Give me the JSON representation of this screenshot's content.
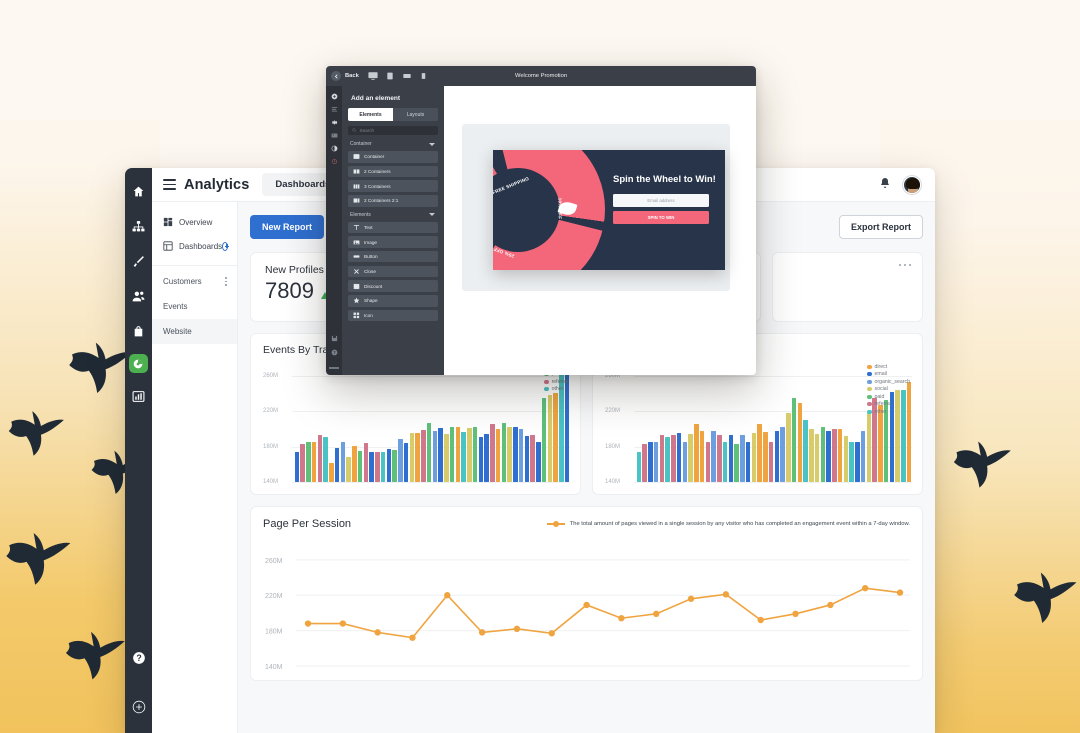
{
  "app": {
    "brand": "Analytics",
    "tab_dashboards": "Dashboards",
    "new_report_label": "New Report",
    "export_report_label": "Export Report",
    "nav_top": [
      {
        "label": "Overview",
        "icon": "grid-icon"
      },
      {
        "label": "Dashboards",
        "icon": "dashboard-icon"
      }
    ],
    "nav_items": [
      {
        "label": "Customers",
        "selected": false
      },
      {
        "label": "Events",
        "selected": false
      },
      {
        "label": "Website",
        "selected": true
      }
    ],
    "rail_icons": [
      "home-icon",
      "sitemap-icon",
      "brush-icon",
      "users-icon",
      "bag-icon",
      "pie-chart-icon",
      "bar-chart-icon"
    ],
    "rail_bottom_icons": [
      "help-icon",
      "add-circle-icon"
    ],
    "topbar_icons": [
      "bell-icon",
      "avatar"
    ]
  },
  "kpi": {
    "title": "New Profiles",
    "value": "7809",
    "trend": "up"
  },
  "chart_data": [
    {
      "type": "bar",
      "title": "Events By Traffic",
      "ylabel": "",
      "xlabel": "",
      "ytick_labels": [
        "260M",
        "220M",
        "180M",
        "140M"
      ],
      "ylim": [
        140,
        270
      ],
      "legend_position": "top-right",
      "legend": [
        "social",
        "paid",
        "referral",
        "other"
      ],
      "series_colors": {
        "social": "#d8cc6a",
        "paid": "#5fc07a",
        "referral": "#d1778c",
        "other": "#49c3c3",
        "direct": "#f0a440",
        "email": "#2f6fd0",
        "organic_search": "#6d9fe0"
      },
      "bars": [
        {
          "series": "email",
          "value": 160
        },
        {
          "series": "referral",
          "value": 169
        },
        {
          "series": "paid",
          "value": 172
        },
        {
          "series": "direct",
          "value": 172
        },
        {
          "series": "referral",
          "value": 180
        },
        {
          "series": "other",
          "value": 177
        },
        {
          "series": "direct",
          "value": 148
        },
        {
          "series": "email",
          "value": 165
        },
        {
          "series": "organic_search",
          "value": 172
        },
        {
          "series": "social",
          "value": 155
        },
        {
          "series": "direct",
          "value": 167
        },
        {
          "series": "paid",
          "value": 162
        },
        {
          "series": "referral",
          "value": 171
        },
        {
          "series": "email",
          "value": 160
        },
        {
          "series": "referral",
          "value": 160
        },
        {
          "series": "other",
          "value": 160
        },
        {
          "series": "email",
          "value": 164
        },
        {
          "series": "paid",
          "value": 163
        },
        {
          "series": "organic_search",
          "value": 175
        },
        {
          "series": "email",
          "value": 171
        },
        {
          "series": "social",
          "value": 182
        },
        {
          "series": "direct",
          "value": 182
        },
        {
          "series": "referral",
          "value": 185
        },
        {
          "series": "paid",
          "value": 193
        },
        {
          "series": "organic_search",
          "value": 184
        },
        {
          "series": "email",
          "value": 187
        },
        {
          "series": "social",
          "value": 181
        },
        {
          "series": "paid",
          "value": 189
        },
        {
          "series": "direct",
          "value": 189
        },
        {
          "series": "other",
          "value": 183
        },
        {
          "series": "social",
          "value": 187
        },
        {
          "series": "paid",
          "value": 189
        },
        {
          "series": "email",
          "value": 177
        },
        {
          "series": "email",
          "value": 181
        },
        {
          "series": "referral",
          "value": 192
        },
        {
          "series": "direct",
          "value": 186
        },
        {
          "series": "paid",
          "value": 193
        },
        {
          "series": "social",
          "value": 189
        },
        {
          "series": "email",
          "value": 189
        },
        {
          "series": "organic_search",
          "value": 186
        },
        {
          "series": "email",
          "value": 178
        },
        {
          "series": "referral",
          "value": 180
        },
        {
          "series": "email",
          "value": 172
        },
        {
          "series": "paid",
          "value": 221
        },
        {
          "series": "social",
          "value": 225
        },
        {
          "series": "direct",
          "value": 227
        },
        {
          "series": "other",
          "value": 248
        },
        {
          "series": "email",
          "value": 255
        }
      ]
    },
    {
      "type": "bar",
      "title": "",
      "ytick_labels": [
        "260M",
        "220M",
        "180M",
        "140M"
      ],
      "ylim": [
        140,
        270
      ],
      "legend_position": "top-right",
      "legend": [
        "direct",
        "email",
        "organic_search",
        "social",
        "paid",
        "referral",
        "other"
      ],
      "bars": [
        {
          "series": "other",
          "value": 160
        },
        {
          "series": "referral",
          "value": 169
        },
        {
          "series": "email",
          "value": 172
        },
        {
          "series": "organic_search",
          "value": 172
        },
        {
          "series": "referral",
          "value": 180
        },
        {
          "series": "other",
          "value": 177
        },
        {
          "series": "referral",
          "value": 180
        },
        {
          "series": "email",
          "value": 182
        },
        {
          "series": "organic_search",
          "value": 172
        },
        {
          "series": "social",
          "value": 181
        },
        {
          "series": "direct",
          "value": 192
        },
        {
          "series": "direct",
          "value": 184
        },
        {
          "series": "referral",
          "value": 172
        },
        {
          "series": "organic_search",
          "value": 184
        },
        {
          "series": "referral",
          "value": 180
        },
        {
          "series": "other",
          "value": 172
        },
        {
          "series": "email",
          "value": 180
        },
        {
          "series": "paid",
          "value": 169
        },
        {
          "series": "organic_search",
          "value": 180
        },
        {
          "series": "email",
          "value": 172
        },
        {
          "series": "social",
          "value": 182
        },
        {
          "series": "direct",
          "value": 192
        },
        {
          "series": "direct",
          "value": 183
        },
        {
          "series": "referral",
          "value": 172
        },
        {
          "series": "email",
          "value": 184
        },
        {
          "series": "organic_search",
          "value": 189
        },
        {
          "series": "social",
          "value": 205
        },
        {
          "series": "paid",
          "value": 221
        },
        {
          "series": "direct",
          "value": 216
        },
        {
          "series": "other",
          "value": 197
        },
        {
          "series": "social",
          "value": 186
        },
        {
          "series": "social",
          "value": 181
        },
        {
          "series": "paid",
          "value": 189
        },
        {
          "series": "email",
          "value": 184
        },
        {
          "series": "referral",
          "value": 186
        },
        {
          "series": "direct",
          "value": 186
        },
        {
          "series": "social",
          "value": 178
        },
        {
          "series": "other",
          "value": 172
        },
        {
          "series": "email",
          "value": 172
        },
        {
          "series": "organic_search",
          "value": 184
        },
        {
          "series": "social",
          "value": 205
        },
        {
          "series": "referral",
          "value": 221
        },
        {
          "series": "direct",
          "value": 214
        },
        {
          "series": "paid",
          "value": 219
        },
        {
          "series": "email",
          "value": 228
        },
        {
          "series": "social",
          "value": 231
        },
        {
          "series": "other",
          "value": 231
        },
        {
          "series": "direct",
          "value": 240
        }
      ]
    },
    {
      "type": "line",
      "title": "Page Per Session",
      "note": "The total amount of pages viewed in a single session by any visitor who has completed an engagement event within a 7-day window.",
      "color": "#f0a440",
      "ytick_labels": [
        "260M",
        "220M",
        "180M",
        "140M"
      ],
      "ylim": [
        140,
        270
      ],
      "values": [
        188,
        188,
        178,
        172,
        220,
        178,
        182,
        177,
        209,
        194,
        199,
        216,
        221,
        192,
        199,
        209,
        228,
        223
      ]
    }
  ],
  "editor": {
    "back_label": "Back",
    "window_title": "Welcome Promotion",
    "devices": [
      "desktop-icon",
      "tablet-portrait-icon",
      "tablet-landscape-icon",
      "mobile-icon"
    ],
    "panel_title": "Add an element",
    "tabs": [
      {
        "label": "Elements",
        "active": true
      },
      {
        "label": "Layouts",
        "active": false
      }
    ],
    "search_placeholder": "Search",
    "sections": [
      {
        "name": "Container",
        "items": [
          {
            "label": "Container",
            "icon": "container-icon"
          },
          {
            "label": "2 Containers",
            "icon": "two-containers-icon"
          },
          {
            "label": "3 Containers",
            "icon": "three-containers-icon"
          },
          {
            "label": "2 Containers 2:1",
            "icon": "two-containers-ratio-icon"
          }
        ]
      },
      {
        "name": "Elements",
        "items": [
          {
            "label": "Text",
            "icon": "text-icon"
          },
          {
            "label": "Image",
            "icon": "image-icon"
          },
          {
            "label": "Button",
            "icon": "button-icon"
          },
          {
            "label": "Close",
            "icon": "close-icon"
          },
          {
            "label": "Discount",
            "icon": "discount-icon"
          },
          {
            "label": "Shape",
            "icon": "star-shape-icon"
          },
          {
            "label": "Icon",
            "icon": "icon-grid-icon"
          }
        ]
      }
    ]
  },
  "popup": {
    "heading": "Spin the Wheel to Win!",
    "email_placeholder": "Email address",
    "button_label": "SPIN TO WIN",
    "wheel_segments": [
      "FREE SHIPPING",
      "10% OFF",
      "25% OFF"
    ],
    "bg_color": "#27344a",
    "accent_color": "#f4677a"
  }
}
